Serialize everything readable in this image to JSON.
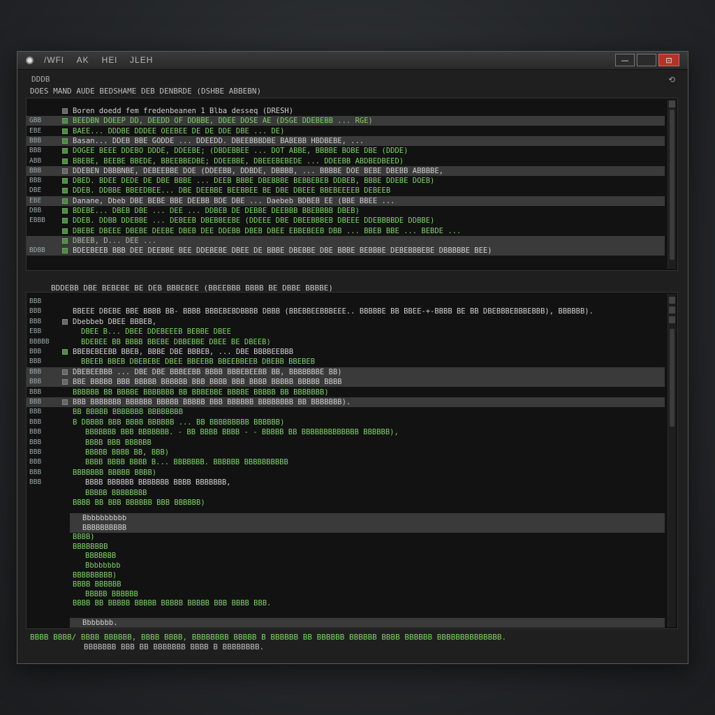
{
  "window": {
    "menus": [
      "/WFl",
      "AK",
      "HEl",
      "JLEH"
    ],
    "buttons": {
      "minimize": "—",
      "maximize": "",
      "close": "⊡"
    }
  },
  "header": {
    "path": "DDDB",
    "subtitle": "DOES MAND AUDE BEDSHAME DEB DENBRDE (DSHBE ABBEBN)",
    "corner_icon": "⟲"
  },
  "top_pane": {
    "rows": [
      {
        "gutter": "",
        "text": "Boren doedd fem fredenbeanen 1 Blba desseq (DRESH)",
        "hl": false,
        "chk": "gray",
        "color": "code"
      },
      {
        "gutter": "GBB",
        "text": "BEEDBN DOEEP DD, DEEDD OF DDBBE, DDEE DOSE AE (DSGE DDEBEBB ... RGE)",
        "hl": true,
        "chk": "green",
        "color": "green"
      },
      {
        "gutter": "EBE",
        "text": "BAEE... DDDBE DDDEE OEEBEE DE DE DDE DBE ... DE)",
        "hl": false,
        "chk": "green",
        "color": "green"
      },
      {
        "gutter": "BBB",
        "text": "Basan... DDEB BBE GODDE ... DDEEDD. DBEEBBBDBE BABEBB HBDBEBE, ...",
        "hl": true,
        "chk": "green",
        "color": "code"
      },
      {
        "gutter": "BBB",
        "text": "DOGEE BEEE DDEBO DDDE, DDEEBE; (DBDEBBEE ... DOT ABBE, BBBBE BOBE DBE (DDDE)",
        "hl": false,
        "chk": "green",
        "color": "green"
      },
      {
        "gutter": "ABB",
        "text": "BBEBE, BEEBE BBEDE, BBEEBBEDBE; DDEEBBE, DBEEEBEBEDE ... DDEEBB ABDBEDBEED)",
        "hl": false,
        "chk": "green",
        "color": "green"
      },
      {
        "gutter": "BBB",
        "text": "DDEBEN DBBBNBE, DEBEEBBE DOE (DDEEBB, DDBDE, DBBBB, ... BBBBE DOE BEBE DBEBB ABBBBE,",
        "hl": true,
        "chk": "gray",
        "color": "code"
      },
      {
        "gutter": "BBB",
        "text": "DBED. BDEE DEDE DE DBE BBBE ... DEEB BBBE DBEBBBE BEBBEBEB DDBEB, BBBE DDEBE DOEB)",
        "hl": false,
        "chk": "green",
        "color": "green"
      },
      {
        "gutter": "DBE",
        "text": "DDEB. DDBBE BBEEDBEE... DBE DEEBBE BEEBBEE BE DBE DBEEE BBEBEEEEB DEBEEB",
        "hl": false,
        "chk": "green",
        "color": "green"
      },
      {
        "gutter": "EBE",
        "text": "Danane, Dbeb DBE BEBE BBE DEEBB BDE DBE ... Daebeb BDBEB EE (BBE BBEE ...",
        "hl": true,
        "chk": "green",
        "color": "code"
      },
      {
        "gutter": "DBB",
        "text": "BDEBE... DBEB DBE ... DEE ... DDBEB DE DEBBE DEEBBB BBEBBBB DBEB)",
        "hl": false,
        "chk": "green",
        "color": "green"
      },
      {
        "gutter": "EBBB",
        "text": "DDEB. DDBB DDEBBE ... DEBEEB DBEBBEEBE (DDEEE DBE DBEEBBBEB DBEEE DDEBBBBDE DDBBE)",
        "hl": false,
        "chk": "green",
        "color": "green"
      },
      {
        "gutter": "",
        "text": "DBEBE DBEEE DBEBE DEEBE DBEB DEE DDEBB DBEB DBEE EBBEBEEB DBB ... BBEB BBE ... BEBDE ...",
        "hl": false,
        "chk": "green",
        "color": "green"
      },
      {
        "gutter": "",
        "text": "DBEEB, D... DEE ...",
        "hl": true,
        "chk": "green",
        "color": "dim"
      },
      {
        "gutter": "BDBB",
        "text": "BDEEBEEB BBB DEE DEEBBE BEE DDEBEBE DBEE DE BBBE DBEBBE DBE BBBE BEBBBE DEBEBBBEBE DBBBBBE BEE)",
        "hl": true,
        "chk": "green",
        "color": "code"
      }
    ]
  },
  "mid_label": "BDDEBB DBE BEBEBE BE DEB BBBEBEE (BBEEBBB BBBB BE DBBE BBBBE)",
  "bottom_pane": {
    "rows": [
      {
        "gutter": "BBB",
        "text": "",
        "hl": false,
        "chk": "",
        "color": "code",
        "indent": 0
      },
      {
        "gutter": "BBB",
        "text": "BBEEE DBEBE BBE BBBB BB- BBBB BBBEBEBDBBBB DBBB (BBEBBEEBBBEEE.. BBBBBE BB BBEE-+-BBBB BE BB DBEBBBEBBBEBBB), BBBBBB).",
        "hl": false,
        "chk": "",
        "color": "code",
        "indent": 0
      },
      {
        "gutter": "BBB",
        "text": "Dbebbeb DBEE BBBEB,",
        "hl": false,
        "chk": "gray",
        "color": "code",
        "indent": 0
      },
      {
        "gutter": "EBB",
        "text": "DBEE B... DBEE DDEBEEEB BEBBE DBEE",
        "hl": false,
        "chk": "",
        "color": "green",
        "indent": 12
      },
      {
        "gutter": "BBBBB",
        "text": "BDEBEE BB BBBB BBEBE DBBEBBE DBEE BE DBEEB)",
        "hl": false,
        "chk": "",
        "color": "green",
        "indent": 12
      },
      {
        "gutter": "BBB",
        "text": "BBEBEBEEBB BBEB, BBBE DBE BBBEB, ... DBE BBBBEEBBB",
        "hl": false,
        "chk": "green",
        "color": "code",
        "indent": 0
      },
      {
        "gutter": "BBB",
        "text": "BBEEB BBEB DBEBEBE DBEE BBEEBB BBEEBBEEB DBEBB BBEBEB",
        "hl": false,
        "chk": "",
        "color": "green",
        "indent": 12
      },
      {
        "gutter": "BBB",
        "text": "DBEBEEBBB ... DBE DBE BBBEEBB BBBB BBBEBEEBB BB, BBBBBBBE BB)",
        "hl": true,
        "chk": "gray",
        "color": "code",
        "indent": 0
      },
      {
        "gutter": "BBB",
        "text": "BBE BBBBB BBB BBBBB BBBBBB BBB BBBB BBB BBBB BBBBB BBBBB BBBB",
        "hl": true,
        "chk": "gray",
        "color": "code",
        "indent": 0
      },
      {
        "gutter": "BBB",
        "text": "BBBBBB BB BBBBE BBBBBBB BB BBBEBBE BBBBE BBBBB BB BBBBBBB)",
        "hl": false,
        "chk": "",
        "color": "green",
        "indent": 0
      },
      {
        "gutter": "BBB",
        "text": "BBB BBBBBBB BBBBBB BBBBB BBBBB BBB BBBBBB BBBBBBBB BB BBBBBBB).",
        "hl": true,
        "chk": "gray",
        "color": "code",
        "indent": 0
      },
      {
        "gutter": "BBB",
        "text": "BB BBBBB BBBBBBB BBBBBBBB",
        "hl": false,
        "chk": "",
        "color": "green",
        "indent": 0
      },
      {
        "gutter": "BBB",
        "text": "B DBBBB BBB BBBB BBBBBB ... BB BBBBBBBBB BBBBBB)",
        "hl": false,
        "chk": "",
        "color": "green",
        "indent": 0
      },
      {
        "gutter": "BBB",
        "text": "BBBBBBB BBB BBBBBBB. - BB BBBB BBBB - - BBBBB BB BBBBBBBBBBBBB BBBBBB),",
        "hl": false,
        "chk": "",
        "color": "green",
        "indent": 18
      },
      {
        "gutter": "BBB",
        "text": "BBBB BBB BBBBBB",
        "hl": false,
        "chk": "",
        "color": "green",
        "indent": 18
      },
      {
        "gutter": "BBB",
        "text": "BBBBB BBBB BB, BBB)",
        "hl": false,
        "chk": "",
        "color": "green",
        "indent": 18
      },
      {
        "gutter": "BBB",
        "text": "BBBB BBBB BBBB B... BBBBBBB. BBBBBB BBBBBBBBBB",
        "hl": false,
        "chk": "",
        "color": "green",
        "indent": 18
      },
      {
        "gutter": "BBB",
        "text": "BBBBBBB BBBBB BBBB)",
        "hl": false,
        "chk": "",
        "color": "green",
        "indent": 0
      },
      {
        "gutter": "BBB",
        "text": "BBBB BBBBBB BBBBBBB BBBB BBBBBBB,",
        "hl": false,
        "chk": "",
        "color": "code",
        "indent": 18
      },
      {
        "gutter": "",
        "text": "BBBBB BBBBBBBB",
        "hl": false,
        "chk": "",
        "color": "green",
        "indent": 18
      },
      {
        "gutter": "",
        "text": "BBBB BB BBB BBBBBB BBB BBBBBB)",
        "hl": false,
        "chk": "",
        "color": "green",
        "indent": 0
      }
    ],
    "lower_rows": [
      {
        "text": "Bbbbbbbbbb",
        "hl": true,
        "color": "code",
        "indent": 14
      },
      {
        "text": "BBBBBBBBBB",
        "hl": true,
        "color": "code",
        "indent": 14
      },
      {
        "text": "BBBB)",
        "hl": false,
        "color": "green",
        "indent": 0
      },
      {
        "text": "BBBBBBBB",
        "hl": false,
        "color": "green",
        "indent": 0
      },
      {
        "text": "BBBBBBB",
        "hl": false,
        "color": "green",
        "indent": 18
      },
      {
        "text": "Bbbbbbbb",
        "hl": false,
        "color": "green",
        "indent": 18
      },
      {
        "text": "BBBBBBBBB)",
        "hl": false,
        "color": "green",
        "indent": 0
      },
      {
        "text": "BBBB BBBBBB",
        "hl": false,
        "color": "green",
        "indent": 0
      },
      {
        "text": "BBBBB BBBBBB",
        "hl": false,
        "color": "green",
        "indent": 18
      },
      {
        "text": "BBBB BB BBBBB BBBBB BBBBB BBBBB BBB BBBB BBB.",
        "hl": false,
        "color": "green",
        "indent": 0
      },
      {
        "text": "",
        "hl": false,
        "color": "green",
        "indent": 0
      },
      {
        "text": "Bbbbbbb.",
        "hl": true,
        "color": "code",
        "indent": 14
      }
    ]
  },
  "footer": {
    "line1": "BBBB BBBB/ BBBB BBBBBB, BBBB BBBB, BBBBBBBB BBBBB B BBBBBB BB BBBBBB BBBBBB BBBB BBBBBB BBBBBBBBBBBBBB.",
    "line2": "BBBBBBB BBB BB BBBBBBB BBBB B BBBBBBBB."
  }
}
